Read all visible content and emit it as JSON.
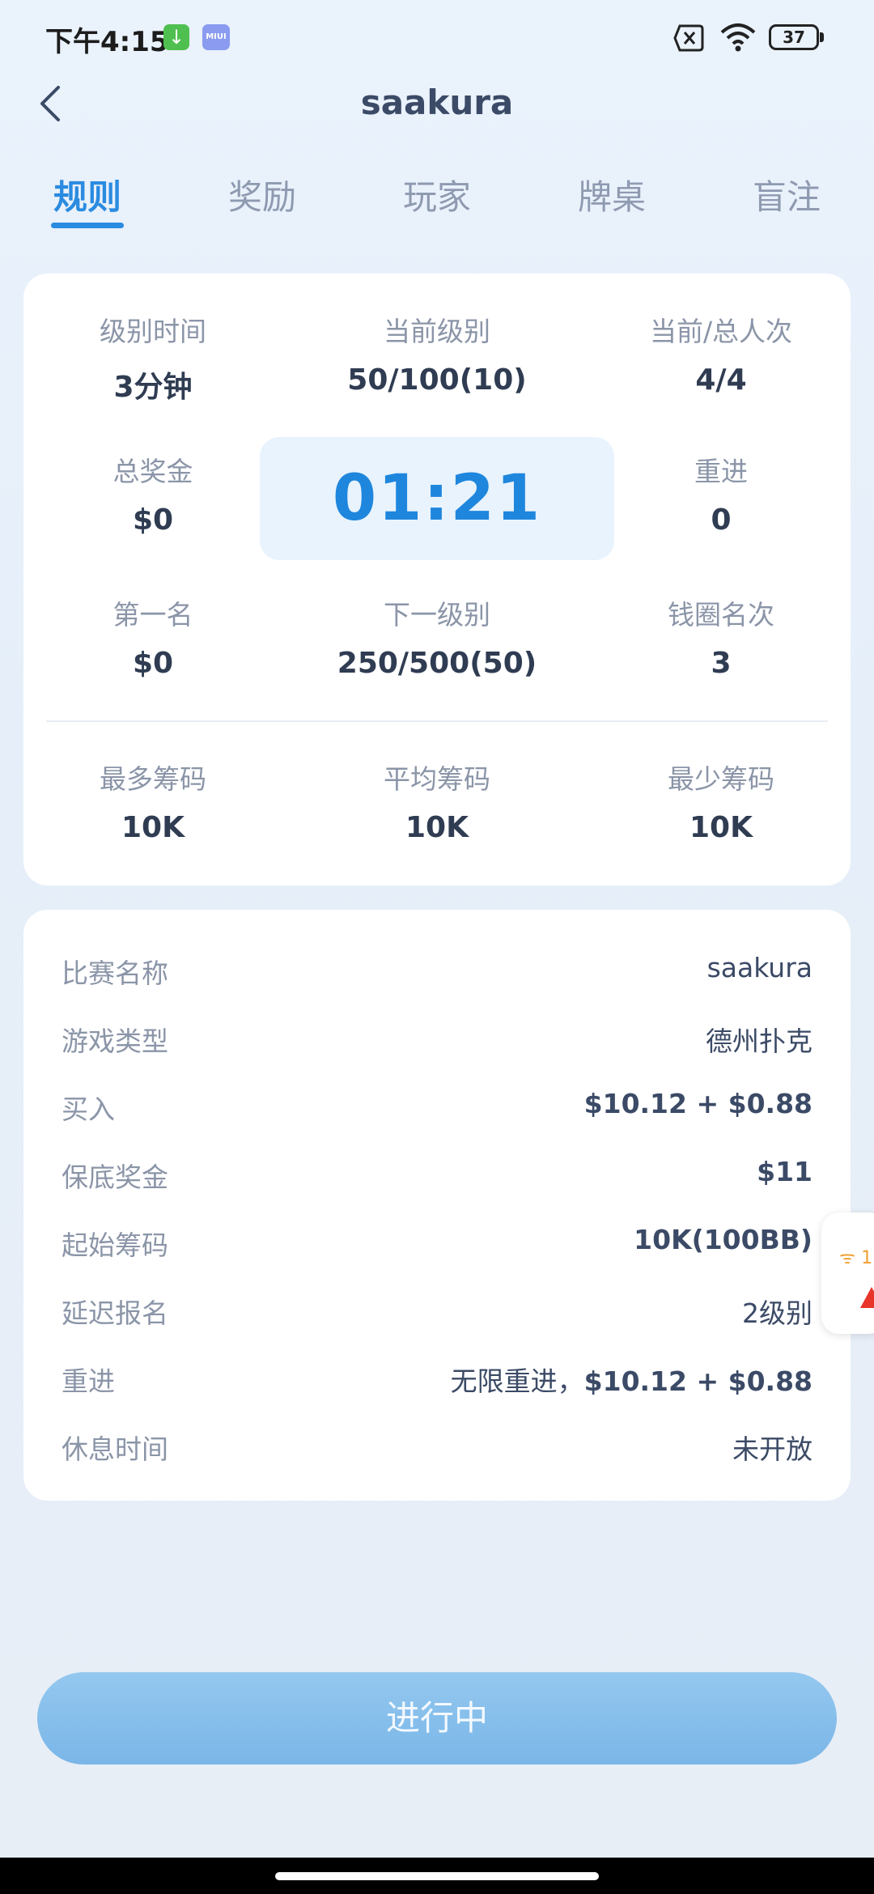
{
  "status_bar": {
    "time": "下午4:15",
    "miui_badge": "MIUI",
    "battery": "37"
  },
  "header": {
    "title": "saakura",
    "back_icon": "chevron-left-icon"
  },
  "tabs": [
    {
      "label": "规则",
      "active": true
    },
    {
      "label": "奖励",
      "active": false
    },
    {
      "label": "玩家",
      "active": false
    },
    {
      "label": "牌桌",
      "active": false
    },
    {
      "label": "盲注",
      "active": false
    }
  ],
  "stats": {
    "level_time": {
      "label": "级别时间",
      "value": "3分钟"
    },
    "current_level": {
      "label": "当前级别",
      "value": "50/100(10)"
    },
    "entries": {
      "label": "当前/总人次",
      "value": "4/4"
    },
    "prize_pool": {
      "label": "总奖金",
      "value": "$0"
    },
    "timer": "01:21",
    "rebuy": {
      "label": "重进",
      "value": "0"
    },
    "first_place": {
      "label": "第一名",
      "value": "$0"
    },
    "next_level": {
      "label": "下一级别",
      "value": "250/500(50)"
    },
    "bubble": {
      "label": "钱圈名次",
      "value": "3"
    },
    "max_chips": {
      "label": "最多筹码",
      "value": "10K"
    },
    "avg_chips": {
      "label": "平均筹码",
      "value": "10K"
    },
    "min_chips": {
      "label": "最少筹码",
      "value": "10K"
    }
  },
  "details": [
    {
      "key": "比赛名称",
      "value": "saakura"
    },
    {
      "key": "游戏类型",
      "value": "德州扑克"
    },
    {
      "key": "买入",
      "value": "$10.12 + $0.88"
    },
    {
      "key": "保底奖金",
      "value": "$11"
    },
    {
      "key": "起始筹码",
      "value": "10K(100BB)"
    },
    {
      "key": "延迟报名",
      "value": "2级别"
    },
    {
      "key": "重进",
      "value_prefix": "无限重进，",
      "value": "$10.12 + $0.88"
    },
    {
      "key": "休息时间",
      "value": "未开放"
    }
  ],
  "floater": {
    "text": "1"
  },
  "action_button": {
    "label": "进行中"
  },
  "colors": {
    "accent": "#2a8be0",
    "timer_bg": "#e8f3fd",
    "button": "#7ab6e8"
  }
}
